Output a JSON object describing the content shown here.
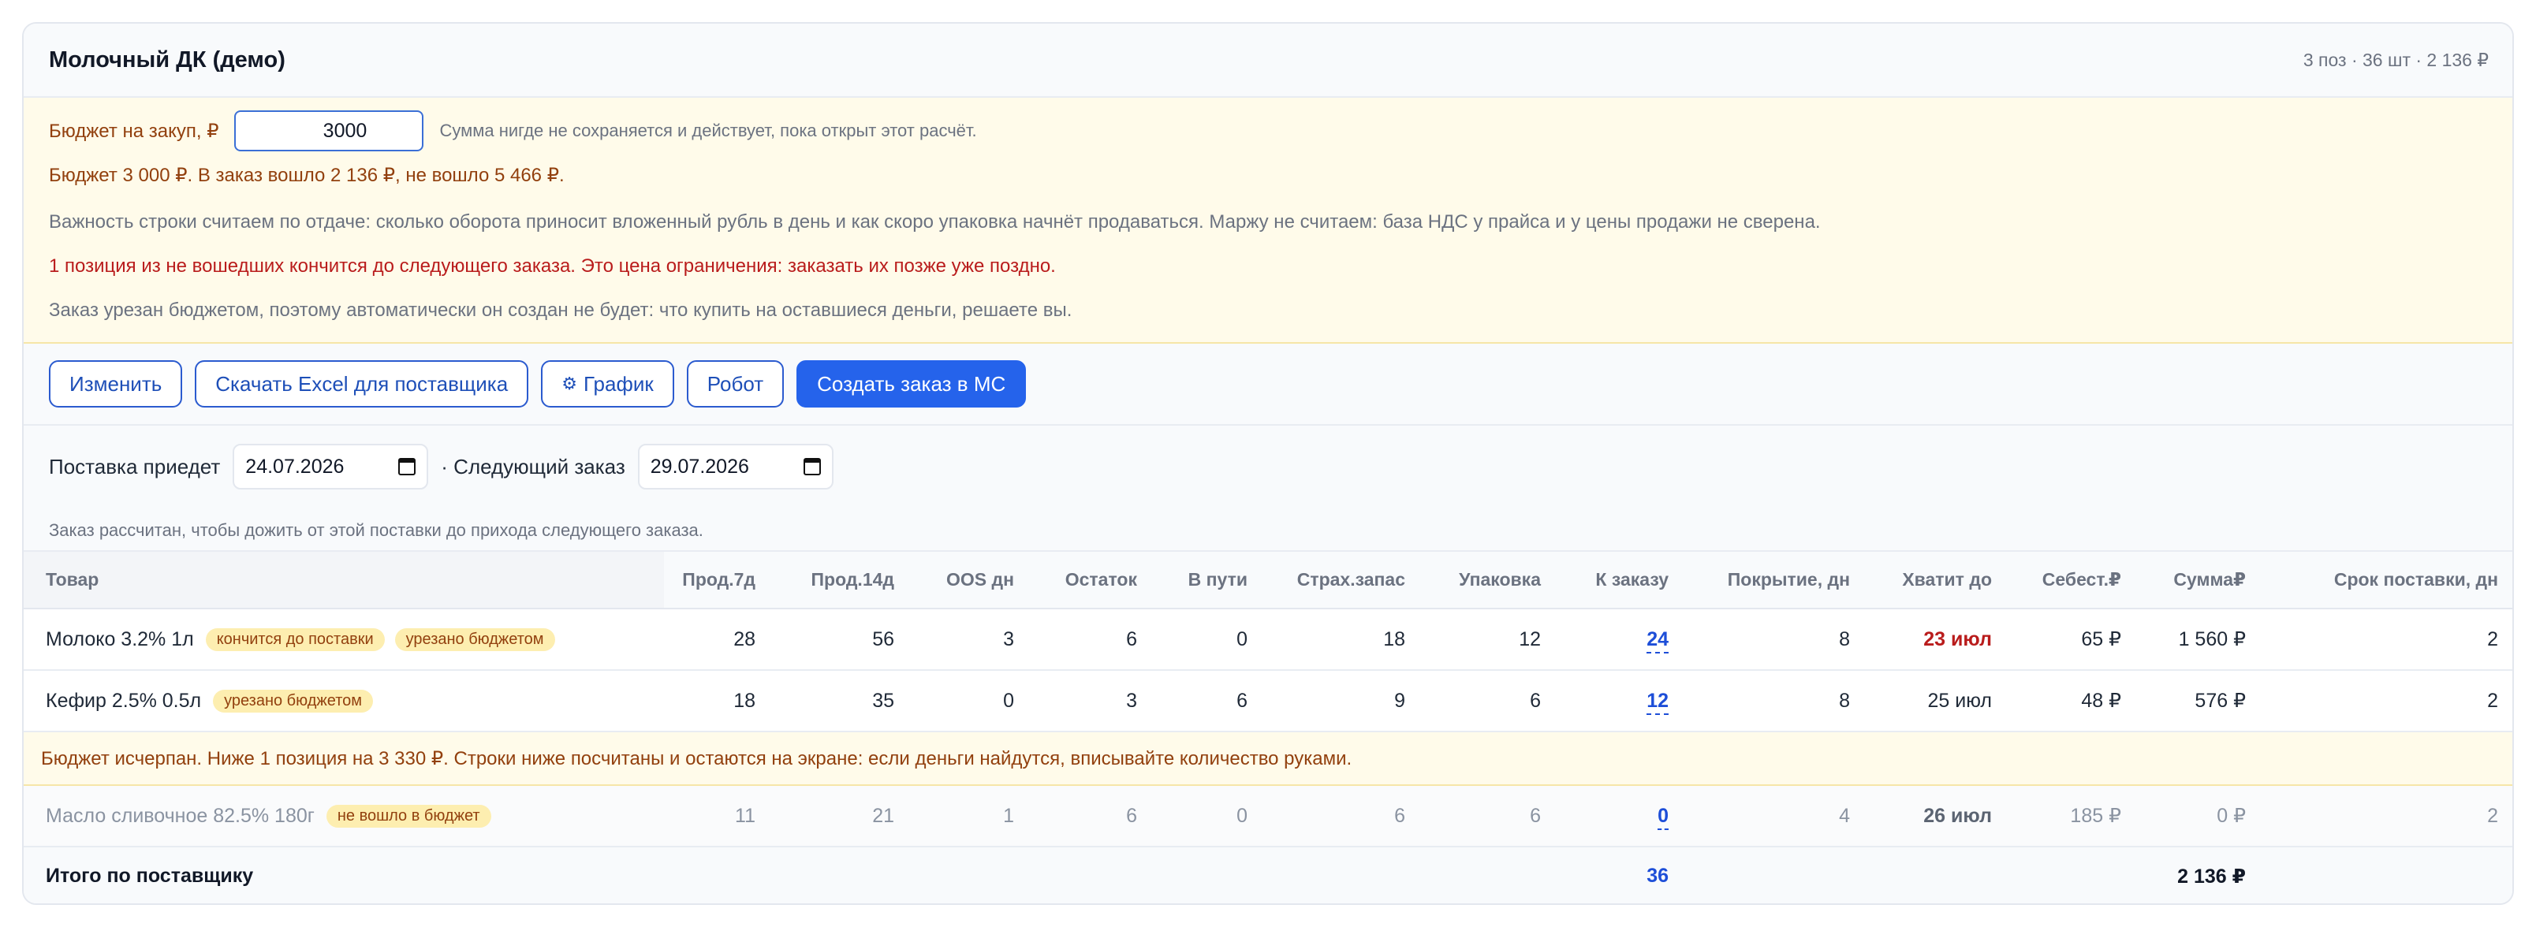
{
  "header": {
    "title": "Молочный ДК (демо)",
    "summary": "3 поз · 36 шт · 2 136 ₽"
  },
  "budget": {
    "label": "Бюджет на закуп, ₽",
    "value": "3000",
    "hint": "Сумма нигде не сохраняется и действует, пока открыт этот расчёт.",
    "line1": "Бюджет 3 000 ₽. В заказ вошло 2 136 ₽, не вошло 5 466 ₽.",
    "line2": "Важность строки считаем по отдаче: сколько оборота приносит вложенный рубль в день и как скоро упаковка начнёт продаваться. Маржу не считаем: база НДС у прайса и у цены продажи не сверена.",
    "line3": "1 позиция из не вошедших кончится до следующего заказа. Это цена ограничения: заказать их позже уже поздно.",
    "line4": "Заказ урезан бюджетом, поэтому автоматически он создан не будет: что купить на оставшиеся деньги, решаете вы."
  },
  "toolbar": {
    "edit": "Изменить",
    "excel": "Скачать Excel для поставщика",
    "gear_icon": "⚙",
    "schedule": "График",
    "robot": "Робот",
    "create": "Создать заказ в МС"
  },
  "delivery": {
    "arrives_label": "Поставка приедет",
    "arrives_date": "24.07.2026",
    "next_label": "· Следующий заказ",
    "next_date": "29.07.2026",
    "note": "Заказ рассчитан, чтобы дожить от этой поставки до прихода следующего заказа."
  },
  "table": {
    "headers": [
      "Товар",
      "Прод.7д",
      "Прод.14д",
      "OOS дн",
      "Остаток",
      "В пути",
      "Страх.запас",
      "Упаковка",
      "К заказу",
      "Покрытие, дн",
      "Хватит до",
      "Себест.₽",
      "Сумма₽",
      "Срок поставки, дн"
    ],
    "rows": [
      {
        "name": "Молоко 3.2% 1л",
        "badges": [
          "кончится до поставки",
          "урезано бюджетом"
        ],
        "sales7": "28",
        "sales14": "56",
        "oos": "3",
        "stock": "6",
        "transit": "0",
        "safety": "18",
        "pack": "12",
        "order": "24",
        "cover": "8",
        "until": "23 июл",
        "cost": "65 ₽",
        "sum": "1 560 ₽",
        "lead": "2"
      },
      {
        "name": "Кефир 2.5% 0.5л",
        "badges": [
          "урезано бюджетом"
        ],
        "sales7": "18",
        "sales14": "35",
        "oos": "0",
        "stock": "3",
        "transit": "6",
        "safety": "9",
        "pack": "6",
        "order": "12",
        "cover": "8",
        "until": "25 июл",
        "cost": "48 ₽",
        "sum": "576 ₽",
        "lead": "2"
      },
      {
        "name": "Масло сливочное 82.5% 180г",
        "badges": [
          "не вошло в бюджет"
        ],
        "sales7": "11",
        "sales14": "21",
        "oos": "1",
        "stock": "6",
        "transit": "0",
        "safety": "6",
        "pack": "6",
        "order": "0",
        "cover": "4",
        "until": "26 июл",
        "cost": "185 ₽",
        "sum": "0 ₽",
        "lead": "2"
      }
    ],
    "notice": "Бюджет исчерпан. Ниже 1 позиция на 3 330 ₽. Строки ниже посчитаны и остаются на экране: если деньги найдутся, вписывайте количество руками.",
    "total": {
      "label": "Итого по поставщику",
      "order": "36",
      "sum": "2 136 ₽"
    }
  }
}
